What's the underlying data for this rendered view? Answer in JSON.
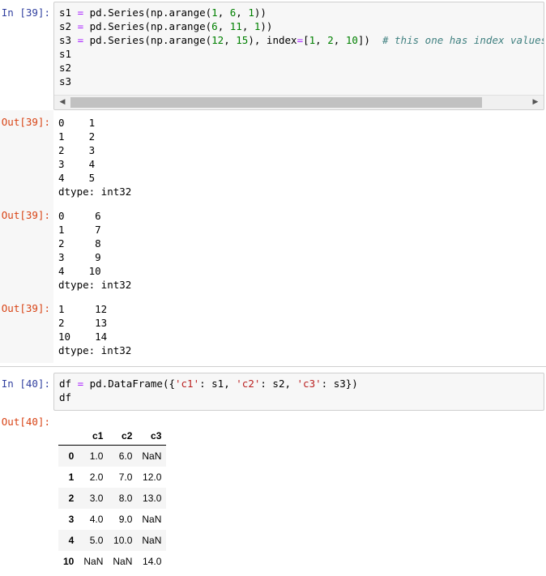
{
  "cell39": {
    "in_prompt": "In [39]:",
    "code": {
      "line1": {
        "a": "s1 ",
        "op": "=",
        "b": " pd.Series(np.arange(",
        "n1": "1",
        "c": ", ",
        "n2": "6",
        "d": ", ",
        "n3": "1",
        "e": "))"
      },
      "line2": {
        "a": "s2 ",
        "op": "=",
        "b": " pd.Series(np.arange(",
        "n1": "6",
        "c": ", ",
        "n2": "11",
        "d": ", ",
        "n3": "1",
        "e": "))"
      },
      "line3": {
        "a": "s3 ",
        "op": "=",
        "b": " pd.Series(np.arange(",
        "n1": "12",
        "c": ", ",
        "n2": "15",
        "d": "), index",
        "op2": "=",
        "e": "[",
        "n3": "1",
        "f": ", ",
        "n4": "2",
        "g": ", ",
        "n5": "10",
        "h": "])  ",
        "comment": "# this one has index values unli"
      },
      "line4": "s1",
      "line5": "s2",
      "line6": "s3"
    },
    "scrollbar": {
      "left_arrow": "◀",
      "right_arrow": "▶"
    },
    "outputs": [
      {
        "prompt": "Out[39]:",
        "lines": [
          "0    1",
          "1    2",
          "2    3",
          "3    4",
          "4    5",
          "dtype: int32"
        ]
      },
      {
        "prompt": "Out[39]:",
        "lines": [
          "0     6",
          "1     7",
          "2     8",
          "3     9",
          "4    10",
          "dtype: int32"
        ]
      },
      {
        "prompt": "Out[39]:",
        "lines": [
          "1     12",
          "2     13",
          "10    14",
          "dtype: int32"
        ]
      }
    ]
  },
  "cell40": {
    "in_prompt": "In [40]:",
    "code": {
      "line1": {
        "a": "df ",
        "op": "=",
        "b": " pd.DataFrame({",
        "s1": "'c1'",
        "c": ": s1, ",
        "s2": "'c2'",
        "d": ": s2, ",
        "s3": "'c3'",
        "e": ": s3})"
      },
      "line2": "df"
    },
    "out_prompt": "Out[40]:",
    "table": {
      "columns": [
        "",
        "c1",
        "c2",
        "c3"
      ],
      "rows": [
        [
          "0",
          "1.0",
          "6.0",
          "NaN"
        ],
        [
          "1",
          "2.0",
          "7.0",
          "12.0"
        ],
        [
          "2",
          "3.0",
          "8.0",
          "13.0"
        ],
        [
          "3",
          "4.0",
          "9.0",
          "NaN"
        ],
        [
          "4",
          "5.0",
          "10.0",
          "NaN"
        ],
        [
          "10",
          "NaN",
          "NaN",
          "14.0"
        ]
      ]
    }
  }
}
